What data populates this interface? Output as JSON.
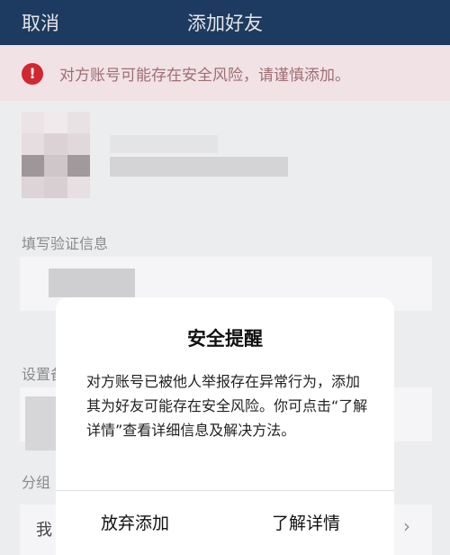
{
  "nav": {
    "cancel_label": "取消",
    "title": "添加好友"
  },
  "warning": {
    "icon": "exclamation-icon",
    "text": "对方账号可能存在安全风险，请谨慎添加。"
  },
  "form": {
    "verify_label": "填写验证信息",
    "remark_label": "设置备",
    "group_label": "分组",
    "group_value": "我"
  },
  "dialog": {
    "title": "安全提醒",
    "body": "对方账号已被他人举报存在异常行为，添加其为好友可能存在安全风险。你可点击“了解详情”查看详细信息及解决方法。",
    "cancel_button": "放弃添加",
    "details_button": "了解详情"
  },
  "colors": {
    "nav_bg": "#1d3b60",
    "warning_bg": "#f1e2e6",
    "warning_icon": "#d2272f",
    "dialog_bg": "#ffffff"
  }
}
